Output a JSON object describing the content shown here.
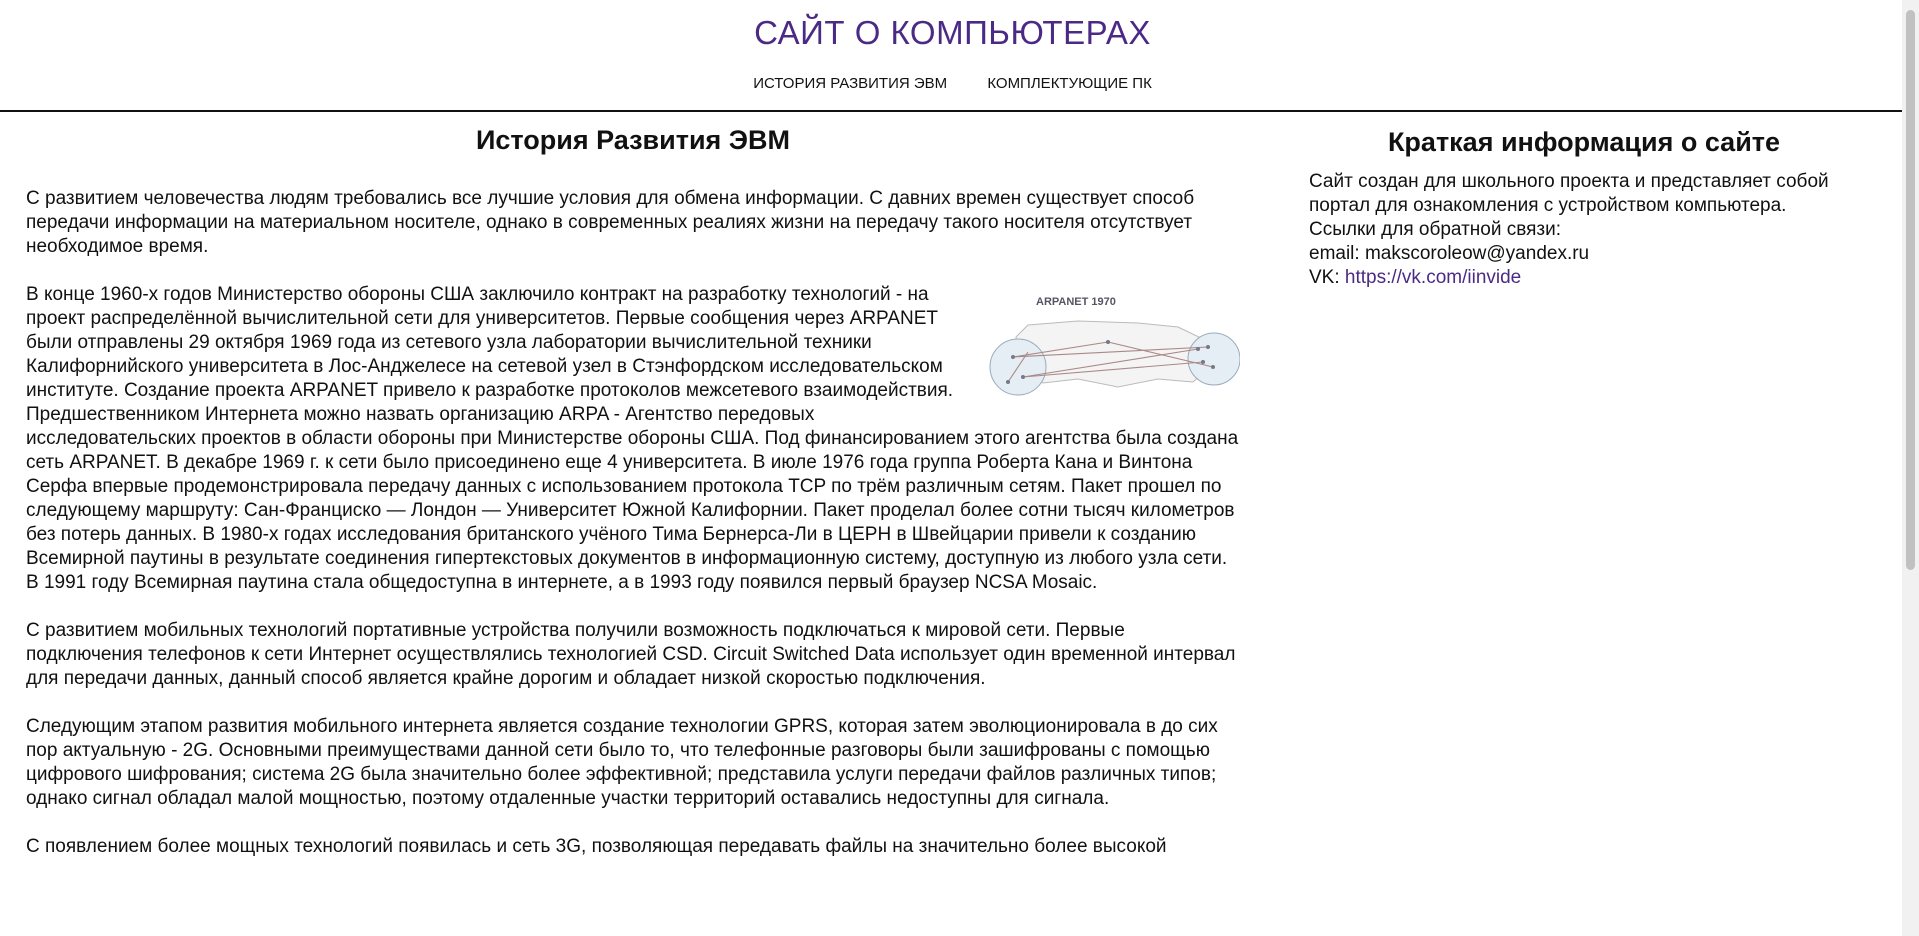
{
  "header": {
    "site_title": "САЙТ О КОМПЬЮТЕРАХ",
    "nav": [
      {
        "label": "ИСТОРИЯ РАЗВИТИЯ ЭВМ"
      },
      {
        "label": "КОМПЛЕКТУЮЩИЕ ПК"
      }
    ]
  },
  "main": {
    "heading": "История Развития ЭВМ",
    "paragraphs": [
      "С развитием человечества людям требовались все лучшие условия для обмена информации. С давних времен существует способ передачи информации на материальном носителе, однако в современных реалиях жизни на передачу такого носителя отсутствует необходимое время.",
      "В конце 1960-х годов Министерство обороны США заключило контракт на разработку технологий - на проект распределённой вычислительной сети для университетов. Первые сообщения через ARPANET были отправлены 29 октября 1969 года из сетевого узла лаборатории вычислительной техники Калифорнийского университета в Лос-Анджелесе на сетевой узел в Стэнфордском исследовательском институте. Создание проекта ARPANET привело к разработке протоколов межсетевого взаимодействия. Предшественником Интернета можно назвать организацию ARPA - Агентство передовых исследовательских проектов в области обороны при Министерстве обороны США. Под финансированием этого агентства была создана сеть ARPANET. В декабре 1969 г. к сети было присоединено еще 4 университета. В июле 1976 года группа Роберта Кана и Винтона Серфа впервые продемонстрировала передачу данных с использованием протокола TCP по трём различным сетям. Пакет прошел по следующему маршруту: Сан-Франциско — Лондон — Университет Южной Калифорнии. Пакет проделал более сотни тысяч километров без потерь данных. В 1980-х годах исследования британского учёного Тима Бернерса-Ли в ЦЕРН в Швейцарии привели к созданию Всемирной паутины в результате соединения гипертекстовых документов в информационную систему, доступную из любого узла сети. В 1991 году Всемирная паутина стала общедоступна в интернете, а в 1993 году появился первый браузер NCSA Mosaic.",
      "С развитием мобильных технологий портативные устройства получили возможность подключаться к мировой сети. Первые подключения телефонов к сети Интернет осуществлялись технологией CSD. Circuit Switched Data использует один временной интервал для передачи данных, данный способ является крайне дорогим и обладает низкой скоростью подключения.",
      "Следующим этапом развития мобильного интернета является создание технологии GPRS, которая затем эволюционировала в до сих пор актуальную - 2G. Основными преимуществами данной сети было то, что телефонные разговоры были зашифрованы с помощью цифрового шифрования; система 2G была значительно более эффективной; представила услуги передачи файлов различных типов; однако сигнал обладал малой мощностью, поэтому отдаленные участки территорий оставались недоступны для сигнала.",
      "С появлением более мощных технологий появилась и сеть 3G, позволяющая передавать файлы на значительно более высокой"
    ],
    "figure_title": "ARPANET 1970"
  },
  "aside": {
    "heading": "Краткая информация о сайте",
    "text": "Сайт создан для школьного проекта и представляет собой портал для ознакомления с устройством компьютера.",
    "feedback_label": "Ссылки для обратной связи:",
    "email_line": "email: makscoroleow@yandex.ru",
    "vk_label": "VK: ",
    "vk_link": "https://vk.com/iinvide"
  },
  "colors": {
    "accent": "#4b2a86"
  }
}
